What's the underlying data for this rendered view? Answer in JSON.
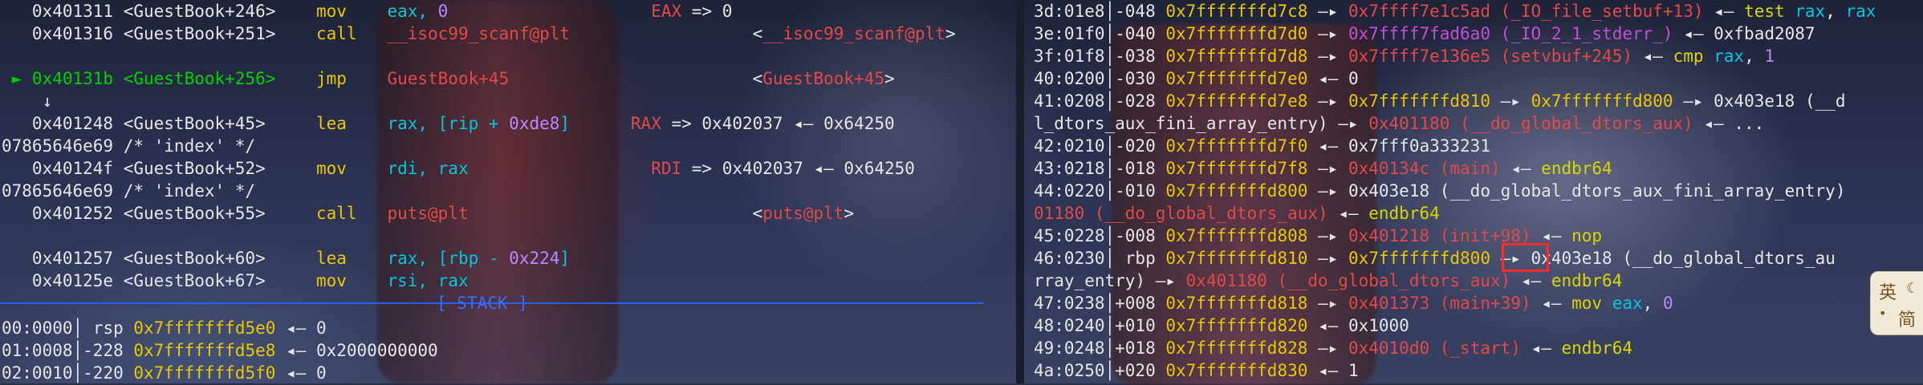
{
  "left": {
    "lines": [
      {
        "parts": [
          {
            "t": "   0x401311 <GuestBook+246>    ",
            "c": "w"
          },
          {
            "t": "mov    ",
            "c": "y"
          },
          {
            "t": "eax, ",
            "c": "c"
          },
          {
            "t": "0",
            "c": "pu"
          },
          {
            "t": "                    ",
            "c": "w"
          },
          {
            "t": "EAX",
            "c": "r"
          },
          {
            "t": " => 0",
            "c": "w"
          }
        ]
      },
      {
        "parts": [
          {
            "t": "   0x401316 <GuestBook+251>    ",
            "c": "w"
          },
          {
            "t": "call   ",
            "c": "y"
          },
          {
            "t": "__isoc99_scanf@plt",
            "c": "r"
          },
          {
            "t": "                  <",
            "c": "w"
          },
          {
            "t": "__isoc99_scanf@plt",
            "c": "r"
          },
          {
            "t": ">",
            "c": "w"
          }
        ]
      },
      {
        "parts": [
          {
            "t": "",
            "c": "w"
          }
        ]
      },
      {
        "parts": [
          {
            "t": " ► 0x40131b <GuestBook+256>    ",
            "c": "g"
          },
          {
            "t": "jmp    ",
            "c": "y"
          },
          {
            "t": "GuestBook+45",
            "c": "r"
          },
          {
            "t": "                        <",
            "c": "w"
          },
          {
            "t": "GuestBook+45",
            "c": "r"
          },
          {
            "t": ">",
            "c": "w"
          }
        ]
      },
      {
        "parts": [
          {
            "t": "    ↓",
            "c": "w"
          }
        ]
      },
      {
        "parts": [
          {
            "t": "   0x401248 <GuestBook+45>     ",
            "c": "w"
          },
          {
            "t": "lea    ",
            "c": "y"
          },
          {
            "t": "rax, [rip + ",
            "c": "c"
          },
          {
            "t": "0xde8",
            "c": "pu"
          },
          {
            "t": "]",
            "c": "c"
          },
          {
            "t": "      ",
            "c": "w"
          },
          {
            "t": "RAX",
            "c": "r"
          },
          {
            "t": " => 0x402037 ◂— 0x64250",
            "c": "w"
          }
        ]
      },
      {
        "parts": [
          {
            "t": "07865646e69 /* 'index' */",
            "c": "w"
          }
        ]
      },
      {
        "parts": [
          {
            "t": "   0x40124f <GuestBook+52>     ",
            "c": "w"
          },
          {
            "t": "mov    ",
            "c": "y"
          },
          {
            "t": "rdi, rax",
            "c": "c"
          },
          {
            "t": "                  ",
            "c": "w"
          },
          {
            "t": "RDI",
            "c": "r"
          },
          {
            "t": " => 0x402037 ◂— 0x64250",
            "c": "w"
          }
        ]
      },
      {
        "parts": [
          {
            "t": "07865646e69 /* 'index' */",
            "c": "w"
          }
        ]
      },
      {
        "parts": [
          {
            "t": "   0x401252 <GuestBook+55>     ",
            "c": "w"
          },
          {
            "t": "call   ",
            "c": "y"
          },
          {
            "t": "puts@plt",
            "c": "r"
          },
          {
            "t": "                            <",
            "c": "w"
          },
          {
            "t": "puts@plt",
            "c": "r"
          },
          {
            "t": ">",
            "c": "w"
          }
        ]
      },
      {
        "parts": [
          {
            "t": "",
            "c": "w"
          }
        ]
      },
      {
        "parts": [
          {
            "t": "   0x401257 <GuestBook+60>     ",
            "c": "w"
          },
          {
            "t": "lea    ",
            "c": "y"
          },
          {
            "t": "rax, [rbp - ",
            "c": "c"
          },
          {
            "t": "0x224",
            "c": "pu"
          },
          {
            "t": "]",
            "c": "c"
          }
        ]
      },
      {
        "parts": [
          {
            "t": "   0x40125e <GuestBook+67>     ",
            "c": "w"
          },
          {
            "t": "mov    ",
            "c": "y"
          },
          {
            "t": "rsi, rax",
            "c": "c"
          }
        ]
      },
      {
        "parts": [
          {
            "t": "",
            "c": "w"
          }
        ]
      },
      {
        "parts": [
          {
            "t": "00:0000",
            "c": "w"
          },
          {
            "t": "│ ",
            "c": "w"
          },
          {
            "t": "rsp ",
            "c": "w"
          },
          {
            "t": "0x7fffffffd5e0",
            "c": "y"
          },
          {
            "t": " ◂— 0",
            "c": "w"
          }
        ]
      },
      {
        "parts": [
          {
            "t": "01:0008",
            "c": "w"
          },
          {
            "t": "│-228 ",
            "c": "w"
          },
          {
            "t": "0x7fffffffd5e8",
            "c": "y"
          },
          {
            "t": " ◂— 0x2000000000",
            "c": "w"
          }
        ]
      },
      {
        "parts": [
          {
            "t": "02:0010",
            "c": "w"
          },
          {
            "t": "│-220 ",
            "c": "w"
          },
          {
            "t": "0x7fffffffd5f0",
            "c": "y"
          },
          {
            "t": " ◂— 0",
            "c": "w"
          }
        ]
      }
    ],
    "stack_label": "[ STACK ]"
  },
  "right": {
    "lines": [
      {
        "parts": [
          {
            "t": "3d:01e8│-048 ",
            "c": "w"
          },
          {
            "t": "0x7fffffffd7c8",
            "c": "y"
          },
          {
            "t": " —▸ ",
            "c": "w"
          },
          {
            "t": "0x7ffff7e1c5ad (_IO_file_setbuf+13)",
            "c": "r"
          },
          {
            "t": " ◂— ",
            "c": "w"
          },
          {
            "t": "test ",
            "c": "ym"
          },
          {
            "t": "rax",
            "c": "c"
          },
          {
            "t": ", ",
            "c": "w"
          },
          {
            "t": "rax",
            "c": "c"
          }
        ]
      },
      {
        "parts": [
          {
            "t": "3e:01f0│-040 ",
            "c": "w"
          },
          {
            "t": "0x7fffffffd7d0",
            "c": "y"
          },
          {
            "t": " —▸ ",
            "c": "w"
          },
          {
            "t": "0x7ffff7fad6a0 (_IO_2_1_stderr_)",
            "c": "m"
          },
          {
            "t": " ◂— 0xfbad2087",
            "c": "w"
          }
        ]
      },
      {
        "parts": [
          {
            "t": "3f:01f8│-038 ",
            "c": "w"
          },
          {
            "t": "0x7fffffffd7d8",
            "c": "y"
          },
          {
            "t": " —▸ ",
            "c": "w"
          },
          {
            "t": "0x7ffff7e136e5 (setvbuf+245)",
            "c": "r"
          },
          {
            "t": " ◂— ",
            "c": "w"
          },
          {
            "t": "cmp ",
            "c": "ym"
          },
          {
            "t": "rax",
            "c": "c"
          },
          {
            "t": ", ",
            "c": "w"
          },
          {
            "t": "1",
            "c": "pu"
          }
        ]
      },
      {
        "parts": [
          {
            "t": "40:0200│-030 ",
            "c": "w"
          },
          {
            "t": "0x7fffffffd7e0",
            "c": "y"
          },
          {
            "t": " ◂— 0",
            "c": "w"
          }
        ]
      },
      {
        "parts": [
          {
            "t": "41:0208│-028 ",
            "c": "w"
          },
          {
            "t": "0x7fffffffd7e8",
            "c": "y"
          },
          {
            "t": " —▸ ",
            "c": "w"
          },
          {
            "t": "0x7fffffffd810",
            "c": "y"
          },
          {
            "t": " —▸ ",
            "c": "w"
          },
          {
            "t": "0x7fffffffd800",
            "c": "y"
          },
          {
            "t": " —▸ 0x403e18 (__d",
            "c": "w"
          }
        ]
      },
      {
        "parts": [
          {
            "t": "l_dtors_aux_fini_array_entry) —▸ ",
            "c": "w"
          },
          {
            "t": "0x401180 (__do_global_dtors_aux)",
            "c": "r"
          },
          {
            "t": " ◂— ...",
            "c": "w"
          }
        ]
      },
      {
        "parts": [
          {
            "t": "42:0210│-020 ",
            "c": "w"
          },
          {
            "t": "0x7fffffffd7f0",
            "c": "y"
          },
          {
            "t": " ◂— 0x7fff0a333231",
            "c": "w"
          }
        ]
      },
      {
        "parts": [
          {
            "t": "43:0218│-018 ",
            "c": "w"
          },
          {
            "t": "0x7fffffffd7f8",
            "c": "y"
          },
          {
            "t": " —▸ ",
            "c": "w"
          },
          {
            "t": "0x40134c (main)",
            "c": "r"
          },
          {
            "t": " ◂— ",
            "c": "w"
          },
          {
            "t": "endbr64",
            "c": "ym"
          }
        ]
      },
      {
        "parts": [
          {
            "t": "44:0220│-010 ",
            "c": "w"
          },
          {
            "t": "0x7fffffffd800",
            "c": "y"
          },
          {
            "t": " —▸ 0x403e18 (__do_global_dtors_aux_fini_array_entry)",
            "c": "w"
          }
        ]
      },
      {
        "parts": [
          {
            "t": "01180 (__do_global_dtors_aux)",
            "c": "r"
          },
          {
            "t": " ◂— ",
            "c": "w"
          },
          {
            "t": "endbr64",
            "c": "ym"
          }
        ]
      },
      {
        "parts": [
          {
            "t": "45:0228│-008 ",
            "c": "w"
          },
          {
            "t": "0x7fffffffd808",
            "c": "y"
          },
          {
            "t": " —▸ ",
            "c": "w"
          },
          {
            "t": "0x401218 (init+98)",
            "c": "r"
          },
          {
            "t": " ◂— ",
            "c": "w"
          },
          {
            "t": "nop",
            "c": "ym"
          }
        ]
      },
      {
        "parts": [
          {
            "t": "46:0230│ rbp ",
            "c": "w"
          },
          {
            "t": "0x7fffffffd810",
            "c": "y"
          },
          {
            "t": " —▸ ",
            "c": "w"
          },
          {
            "t": "0x7fffffffd800",
            "c": "y"
          },
          {
            "t": " —▸ 0x403e18 (__do_global_dtors_au",
            "c": "w"
          }
        ]
      },
      {
        "parts": [
          {
            "t": "rray_entry) —▸ ",
            "c": "w"
          },
          {
            "t": "0x401180 (__do_global_dtors_aux)",
            "c": "r"
          },
          {
            "t": " ◂— ",
            "c": "w"
          },
          {
            "t": "endbr64",
            "c": "ym"
          }
        ]
      },
      {
        "parts": [
          {
            "t": "47:0238│+008 ",
            "c": "w"
          },
          {
            "t": "0x7fffffffd818",
            "c": "y"
          },
          {
            "t": " —▸ ",
            "c": "w"
          },
          {
            "t": "0x401373 (main+39)",
            "c": "r"
          },
          {
            "t": " ◂— ",
            "c": "w"
          },
          {
            "t": "mov ",
            "c": "ym"
          },
          {
            "t": "eax",
            "c": "c"
          },
          {
            "t": ", ",
            "c": "w"
          },
          {
            "t": "0",
            "c": "pu"
          }
        ]
      },
      {
        "parts": [
          {
            "t": "48:0240│+010 ",
            "c": "w"
          },
          {
            "t": "0x7fffffffd820",
            "c": "y"
          },
          {
            "t": " ◂— 0x1000",
            "c": "w"
          }
        ]
      },
      {
        "parts": [
          {
            "t": "49:0248│+018 ",
            "c": "w"
          },
          {
            "t": "0x7fffffffd828",
            "c": "y"
          },
          {
            "t": " —▸ ",
            "c": "w"
          },
          {
            "t": "0x4010d0 (_start)",
            "c": "r"
          },
          {
            "t": " ◂— ",
            "c": "w"
          },
          {
            "t": "endbr64",
            "c": "ym"
          }
        ]
      },
      {
        "parts": [
          {
            "t": "4a:0250│+020 ",
            "c": "w"
          },
          {
            "t": "0x7fffffffd830",
            "c": "y"
          },
          {
            "t": " ◂— 1",
            "c": "w"
          }
        ]
      }
    ]
  },
  "ime": {
    "top": "英",
    "bottom": "简"
  },
  "colors": {
    "background": "#2a2f45",
    "text": "#e6e6e6",
    "red": "#e04a4a",
    "green": "#00d200",
    "yellow": "#e8c800",
    "cyan": "#00c8dc",
    "magenta": "#c050d8",
    "stack_rule": "#2a5cff",
    "highlight_box": "#ff2a2a"
  }
}
